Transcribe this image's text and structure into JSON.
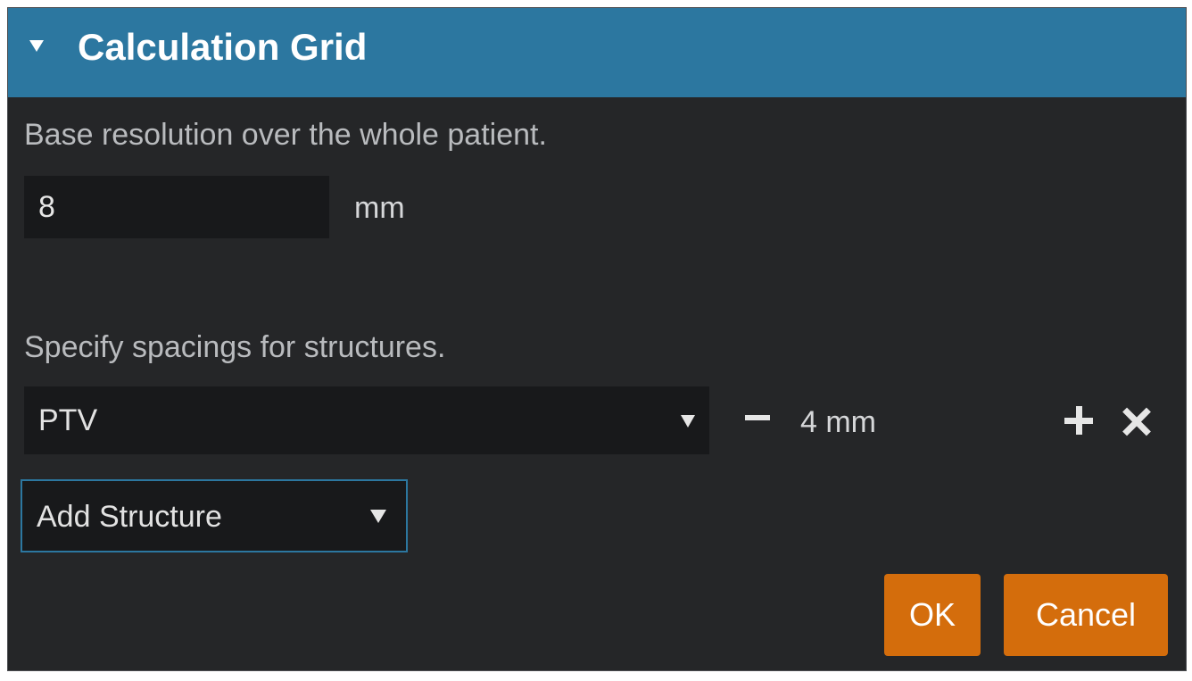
{
  "panel": {
    "title": "Calculation Grid",
    "base_description": "Base resolution over the whole patient.",
    "base_resolution": {
      "value": "8",
      "unit": "mm"
    },
    "structure_description": "Specify spacings for structures.",
    "structures": [
      {
        "name": "PTV",
        "spacing": "4 mm"
      }
    ],
    "add_structure_label": "Add Structure",
    "ok_label": "OK",
    "cancel_label": "Cancel"
  },
  "colors": {
    "header": "#2c77a0",
    "panel_bg": "#252628",
    "input_bg": "#18191b",
    "accent_button": "#d46d0c",
    "focus_border": "#2c77a0"
  },
  "icons": {
    "collapse": "triangle-down-icon",
    "dropdown": "caret-down-icon",
    "decrement": "minus-icon",
    "increment": "plus-icon",
    "remove": "close-icon"
  }
}
